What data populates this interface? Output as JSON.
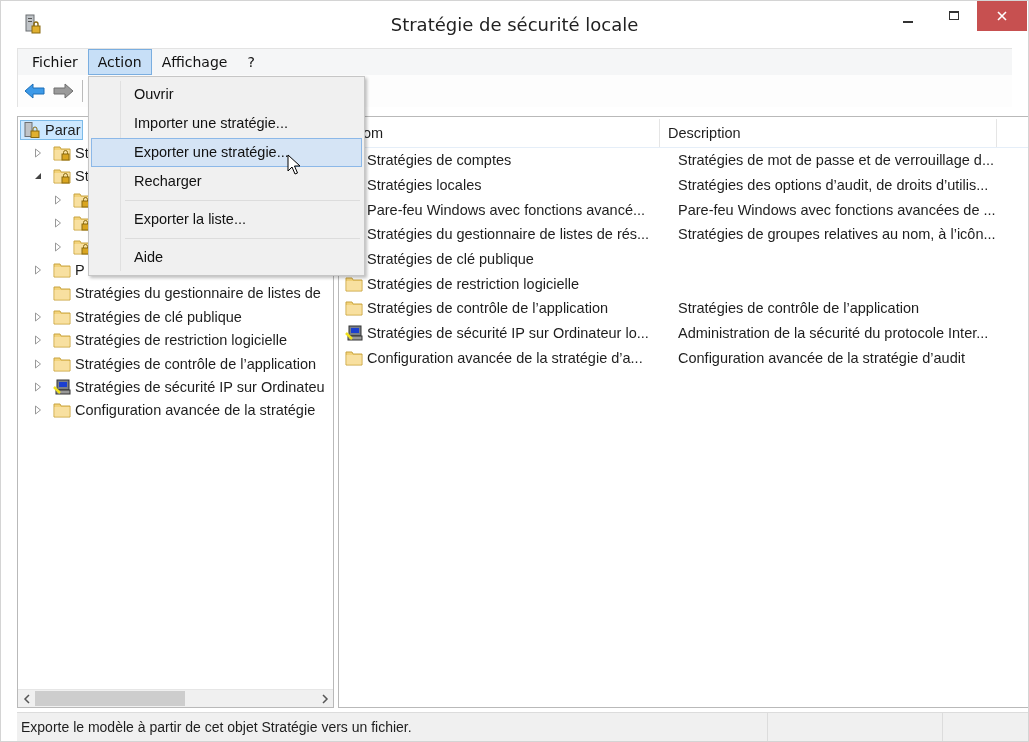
{
  "window": {
    "title": "Stratégie de sécurité locale"
  },
  "menubar": [
    {
      "label": "Fichier",
      "selected": false
    },
    {
      "label": "Action",
      "selected": true
    },
    {
      "label": "Affichage",
      "selected": false
    },
    {
      "label": "?",
      "selected": false
    }
  ],
  "action_menu": {
    "items": [
      {
        "label": "Ouvrir",
        "selected": false
      },
      {
        "label": "Importer une stratégie...",
        "selected": false
      },
      {
        "label": "Exporter une stratégie...",
        "selected": true
      },
      {
        "label": "Recharger",
        "selected": false,
        "separator_after": true
      },
      {
        "label": "Exporter la liste...",
        "selected": false,
        "separator_after": true
      },
      {
        "label": "Aide",
        "selected": false
      }
    ]
  },
  "tree": {
    "root": {
      "label": "Parar",
      "selected": true
    },
    "children": [
      {
        "label": "St",
        "kind": "lockfolder",
        "expanded": false
      },
      {
        "label": "St",
        "kind": "lockfolder",
        "expanded": true,
        "children": [
          {
            "kind": "lockfolder",
            "expanded": false
          },
          {
            "kind": "lockfolder",
            "expanded": false
          },
          {
            "kind": "lockfolder",
            "expanded": false
          }
        ]
      },
      {
        "label": "P",
        "kind": "folder",
        "expanded": false
      },
      {
        "label": "Stratégies du gestionnaire de listes de",
        "kind": "folder"
      },
      {
        "label": "Stratégies de clé publique",
        "kind": "folder",
        "expanded": false
      },
      {
        "label": "Stratégies de restriction logicielle",
        "kind": "folder",
        "expanded": false
      },
      {
        "label": "Stratégies de contrôle de l’application",
        "kind": "folder",
        "expanded": false
      },
      {
        "label": "Stratégies de sécurité IP sur Ordinateu",
        "kind": "ipsec",
        "expanded": false
      },
      {
        "label": "Configuration avancée de la stratégie",
        "kind": "folder",
        "expanded": false
      }
    ]
  },
  "list": {
    "columns": [
      "om",
      "Description"
    ],
    "rows": [
      {
        "name": "Stratégies de comptes",
        "description": "Stratégies de mot de passe et de verrouillage d..."
      },
      {
        "name": "Stratégies locales",
        "description": "Stratégies des options d’audit, de droits d’utilis..."
      },
      {
        "name": "Pare-feu Windows avec fonctions avancé...",
        "description": "Pare-feu Windows avec fonctions avancées de ..."
      },
      {
        "name": "Stratégies du gestionnaire de listes de rés...",
        "description": "Stratégies de groupes relatives au nom, à l’icôn..."
      },
      {
        "name": "Stratégies de clé publique"
      },
      {
        "name": "Stratégies de restriction logicielle",
        "kind": "folder"
      },
      {
        "name": "Stratégies de contrôle de l’application",
        "kind": "folder",
        "description": "Stratégies de contrôle de l’application"
      },
      {
        "name": "Stratégies de sécurité IP sur Ordinateur lo...",
        "kind": "ipsec",
        "description": "Administration de la sécurité du protocole Inter..."
      },
      {
        "name": "Configuration avancée de la stratégie d’a...",
        "kind": "folder",
        "description": "Configuration avancée de la stratégie d’audit"
      }
    ]
  },
  "status_bar": {
    "text": "Exporte le modèle à partir de cet objet Stratégie vers un fichier."
  }
}
